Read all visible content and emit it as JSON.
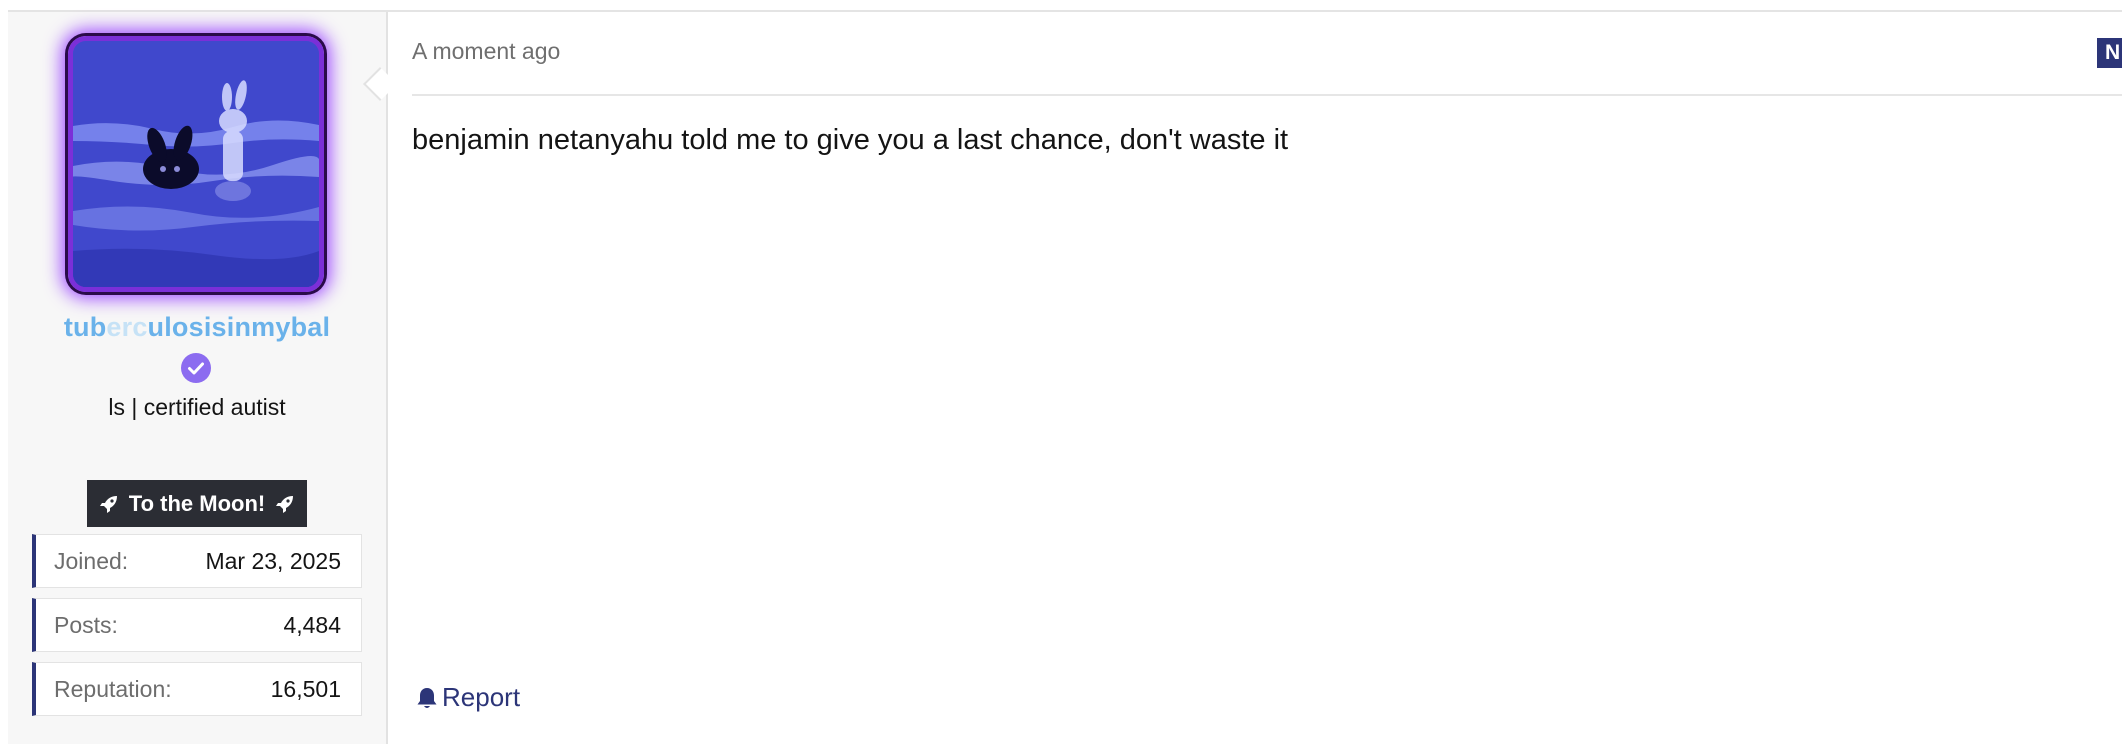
{
  "post": {
    "timestamp": "A moment ago",
    "new_badge": "N",
    "message": "benjamin netanyahu told me to give you a last chance, don't waste it",
    "report_label": "Report"
  },
  "author": {
    "username_part1": "tub",
    "username_part2": "erc",
    "username_part3": "ulosisinmybal",
    "user_title": "ls | certified autist",
    "banner": "To the Moon!",
    "stats": {
      "joined_label": "Joined:",
      "joined_value": "Mar 23, 2025",
      "posts_label": "Posts:",
      "posts_value": "4,484",
      "reputation_label": "Reputation:",
      "reputation_value": "16,501"
    }
  },
  "colors": {
    "accent": "#2c3578",
    "username": "#6ab2ea",
    "avatar_glow": "#9b45ff",
    "verified": "#8c6cf0"
  },
  "icons": {
    "verified": "verified-check-icon",
    "banner": "rocket-icon",
    "report": "bell-icon"
  }
}
